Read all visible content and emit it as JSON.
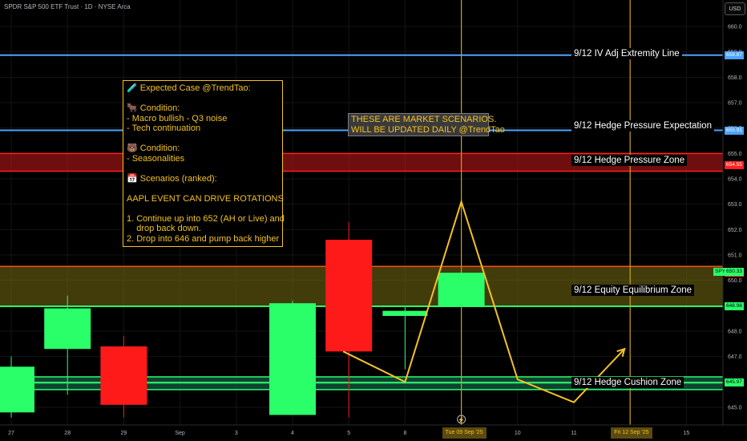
{
  "header": {
    "ticker_line": "SPDR S&P 500 ETF Trust · 1D · NYSE Arca",
    "currency_button": "USD"
  },
  "chart_data": {
    "type": "candlestick",
    "x_ticks": [
      "27",
      "28",
      "29",
      "Sep",
      "3",
      "4",
      "5",
      "8",
      "9",
      "10",
      "11",
      "12",
      "15"
    ],
    "x_tick_index": [
      0,
      1,
      2,
      3,
      4,
      5,
      6,
      7,
      8,
      9,
      10,
      11,
      12
    ],
    "y_ticks": [
      645,
      646,
      647,
      648,
      649,
      650,
      651,
      652,
      653,
      654,
      655,
      656,
      657,
      658,
      659,
      660
    ],
    "ylim": [
      644.6,
      660.6
    ],
    "candles": [
      {
        "i": 0,
        "open": 644.8,
        "high": 647.0,
        "low": 644.6,
        "close": 646.6,
        "color": "#2aff6a"
      },
      {
        "i": 1,
        "open": 647.3,
        "high": 649.4,
        "low": 645.5,
        "close": 648.9,
        "color": "#2aff6a"
      },
      {
        "i": 2,
        "open": 647.4,
        "high": 647.8,
        "low": 644.6,
        "close": 645.1,
        "color": "#ff1a1a"
      },
      {
        "i": 5,
        "open": 644.7,
        "high": 649.2,
        "low": 644.7,
        "close": 649.1,
        "color": "#2aff6a"
      },
      {
        "i": 6,
        "open": 651.6,
        "high": 652.3,
        "low": 644.6,
        "close": 647.2,
        "color": "#ff1a1a"
      },
      {
        "i": 7,
        "open": 648.6,
        "high": 649.0,
        "low": 646.5,
        "close": 648.8,
        "color": "#2aff6a"
      },
      {
        "i": 8,
        "open": 649.0,
        "high": 650.3,
        "low": 649.0,
        "close": 650.3,
        "color": "#2aff6a"
      }
    ],
    "horizontal_lines": [
      {
        "label": "9/12 IV Adj Extremity Line",
        "price": 658.87,
        "price_label": "658.87",
        "color": "#4da3ff"
      },
      {
        "label": "9/12 Hedge Pressure Expectation",
        "price": 655.91,
        "price_label": "655.91",
        "color": "#4da3ff"
      },
      {
        "label": "",
        "price": 648.98,
        "price_label": "648.98",
        "color": "#2aff6a"
      },
      {
        "label": "",
        "price": 645.97,
        "price_label": "645.97",
        "color": "#2aff6a"
      }
    ],
    "zones": [
      {
        "label": "9/12 Hedge Pressure Zone",
        "from": 654.3,
        "to": 655.0,
        "price": 654.55,
        "price_label": "654.55",
        "color": "#ff2020",
        "fill": "rgba(200,25,25,0.55)"
      },
      {
        "label": "9/12 Equity Equilibrium Zone",
        "from": 648.98,
        "to": 650.55,
        "price": 650.3,
        "price_label": "650.30",
        "color": "#ff4d1a",
        "fill": "rgba(120,110,20,0.55)"
      },
      {
        "label": "9/12 Hedge Cushion Zone",
        "from": 645.7,
        "to": 646.2,
        "price": 645.97,
        "price_label": "",
        "color": "#2aff6a",
        "fill": "rgba(30,120,90,0.55)"
      }
    ],
    "last_price": {
      "symbol": "SPY",
      "price": 650.33,
      "price_label": "650.33"
    },
    "scenario_path": [
      {
        "i": 5.9,
        "price": 647.2
      },
      {
        "i": 7.0,
        "price": 646.0
      },
      {
        "i": 8.0,
        "price": 653.1
      },
      {
        "i": 9.0,
        "price": 646.1
      },
      {
        "i": 10.0,
        "price": 645.2
      },
      {
        "i": 10.9,
        "price": 647.3
      }
    ],
    "vertical_markers": [
      {
        "i": 8,
        "label": "Tue 09 Sep '25"
      },
      {
        "i": 11,
        "label": "Fri 12 Sep '25"
      }
    ]
  },
  "note": {
    "lines": [
      "🧪 Expected Case @TrendTao:",
      "",
      "🐂 Condition:",
      "- Macro bullish - Q3 noise",
      "- Tech continuation",
      "",
      "🐻 Condition:",
      "- Seasonalities",
      "",
      "📅 Scenarios (ranked):",
      "",
      "AAPL EVENT CAN DRIVE ROTATIONS",
      "",
      "1. Continue up into 652 (AH or Live) and",
      "    drop back down.",
      "2. Drop into 646 and pump back higher"
    ]
  },
  "banner": {
    "lines": [
      "THESE ARE MARKET SCENARIOS.",
      "WILL BE UPDATED DAILY @TrendTao"
    ]
  },
  "colors": {
    "accent": "#f4c224",
    "up": "#2aff6a",
    "down": "#ff1a1a",
    "blue_line": "#4da3ff"
  }
}
